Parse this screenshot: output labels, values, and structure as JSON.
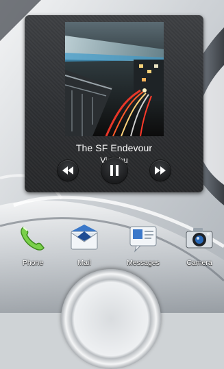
{
  "music_widget": {
    "track_title": "The SF Endevour",
    "artist": "Vintabu",
    "controls": {
      "previous_icon": "rewind-icon",
      "play_pause_icon": "pause-icon",
      "next_icon": "fast-forward-icon"
    },
    "album_art": "night-city-street-light-trails"
  },
  "dock": {
    "items": [
      {
        "label": "Phone",
        "icon": "phone-handset-icon"
      },
      {
        "label": "Mail",
        "icon": "envelope-icon"
      },
      {
        "label": "Messages",
        "icon": "message-bubble-icon"
      },
      {
        "label": "Camera",
        "icon": "camera-icon"
      }
    ]
  },
  "colors": {
    "widget_bg": "#2f3134",
    "text": "#ffffff",
    "wallpaper_light": "#e6e8ea",
    "wallpaper_dark": "#3a3f46"
  }
}
